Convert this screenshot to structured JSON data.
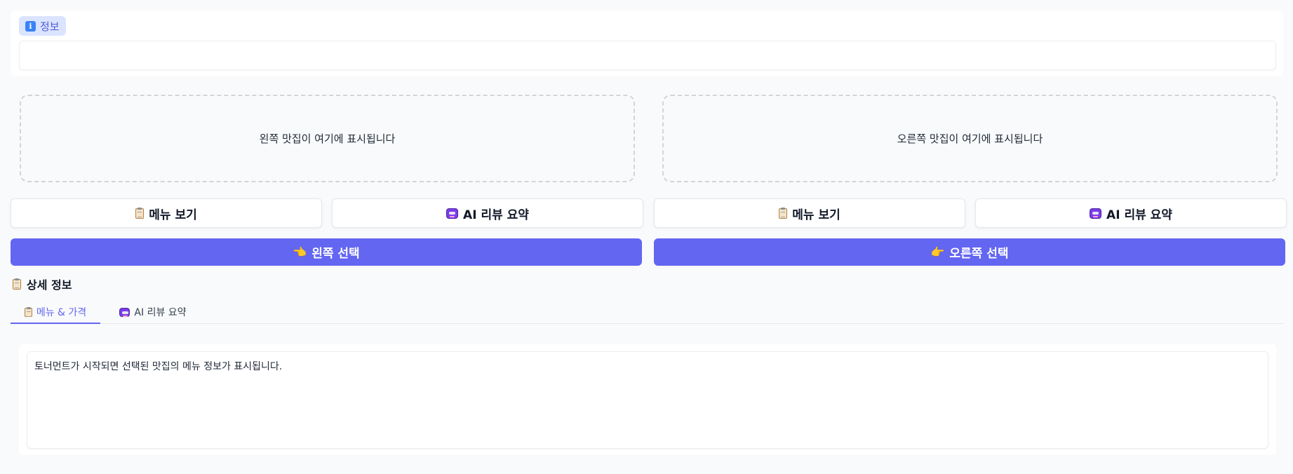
{
  "info": {
    "badge_label": "정보",
    "icon": "info-icon"
  },
  "left": {
    "placeholder": "왼쪽 맛집이 여기에 표시됩니다",
    "menu_button": "메뉴 보기",
    "ai_button": "AI 리뷰 요약",
    "select_button": "왼쪽 선택",
    "select_icon": "👈"
  },
  "right": {
    "placeholder": "오른쪽 맛집이 여기에 표시됩니다",
    "menu_button": "메뉴 보기",
    "ai_button": "AI 리뷰 요약",
    "select_button": "오른쪽 선택",
    "select_icon": "👉"
  },
  "details": {
    "title": "상세 정보",
    "tabs": [
      {
        "label": "메뉴 & 가격",
        "icon": "clipboard-icon",
        "active": true
      },
      {
        "label": "AI 리뷰 요약",
        "icon": "robot-icon",
        "active": false
      }
    ],
    "content": "토너먼트가 시작되면 선택된 맛집의 메뉴 정보가 표시됩니다."
  },
  "colors": {
    "primary": "#6366f1",
    "badge_bg": "#dbe4ff",
    "page_bg": "#f9fafb"
  }
}
